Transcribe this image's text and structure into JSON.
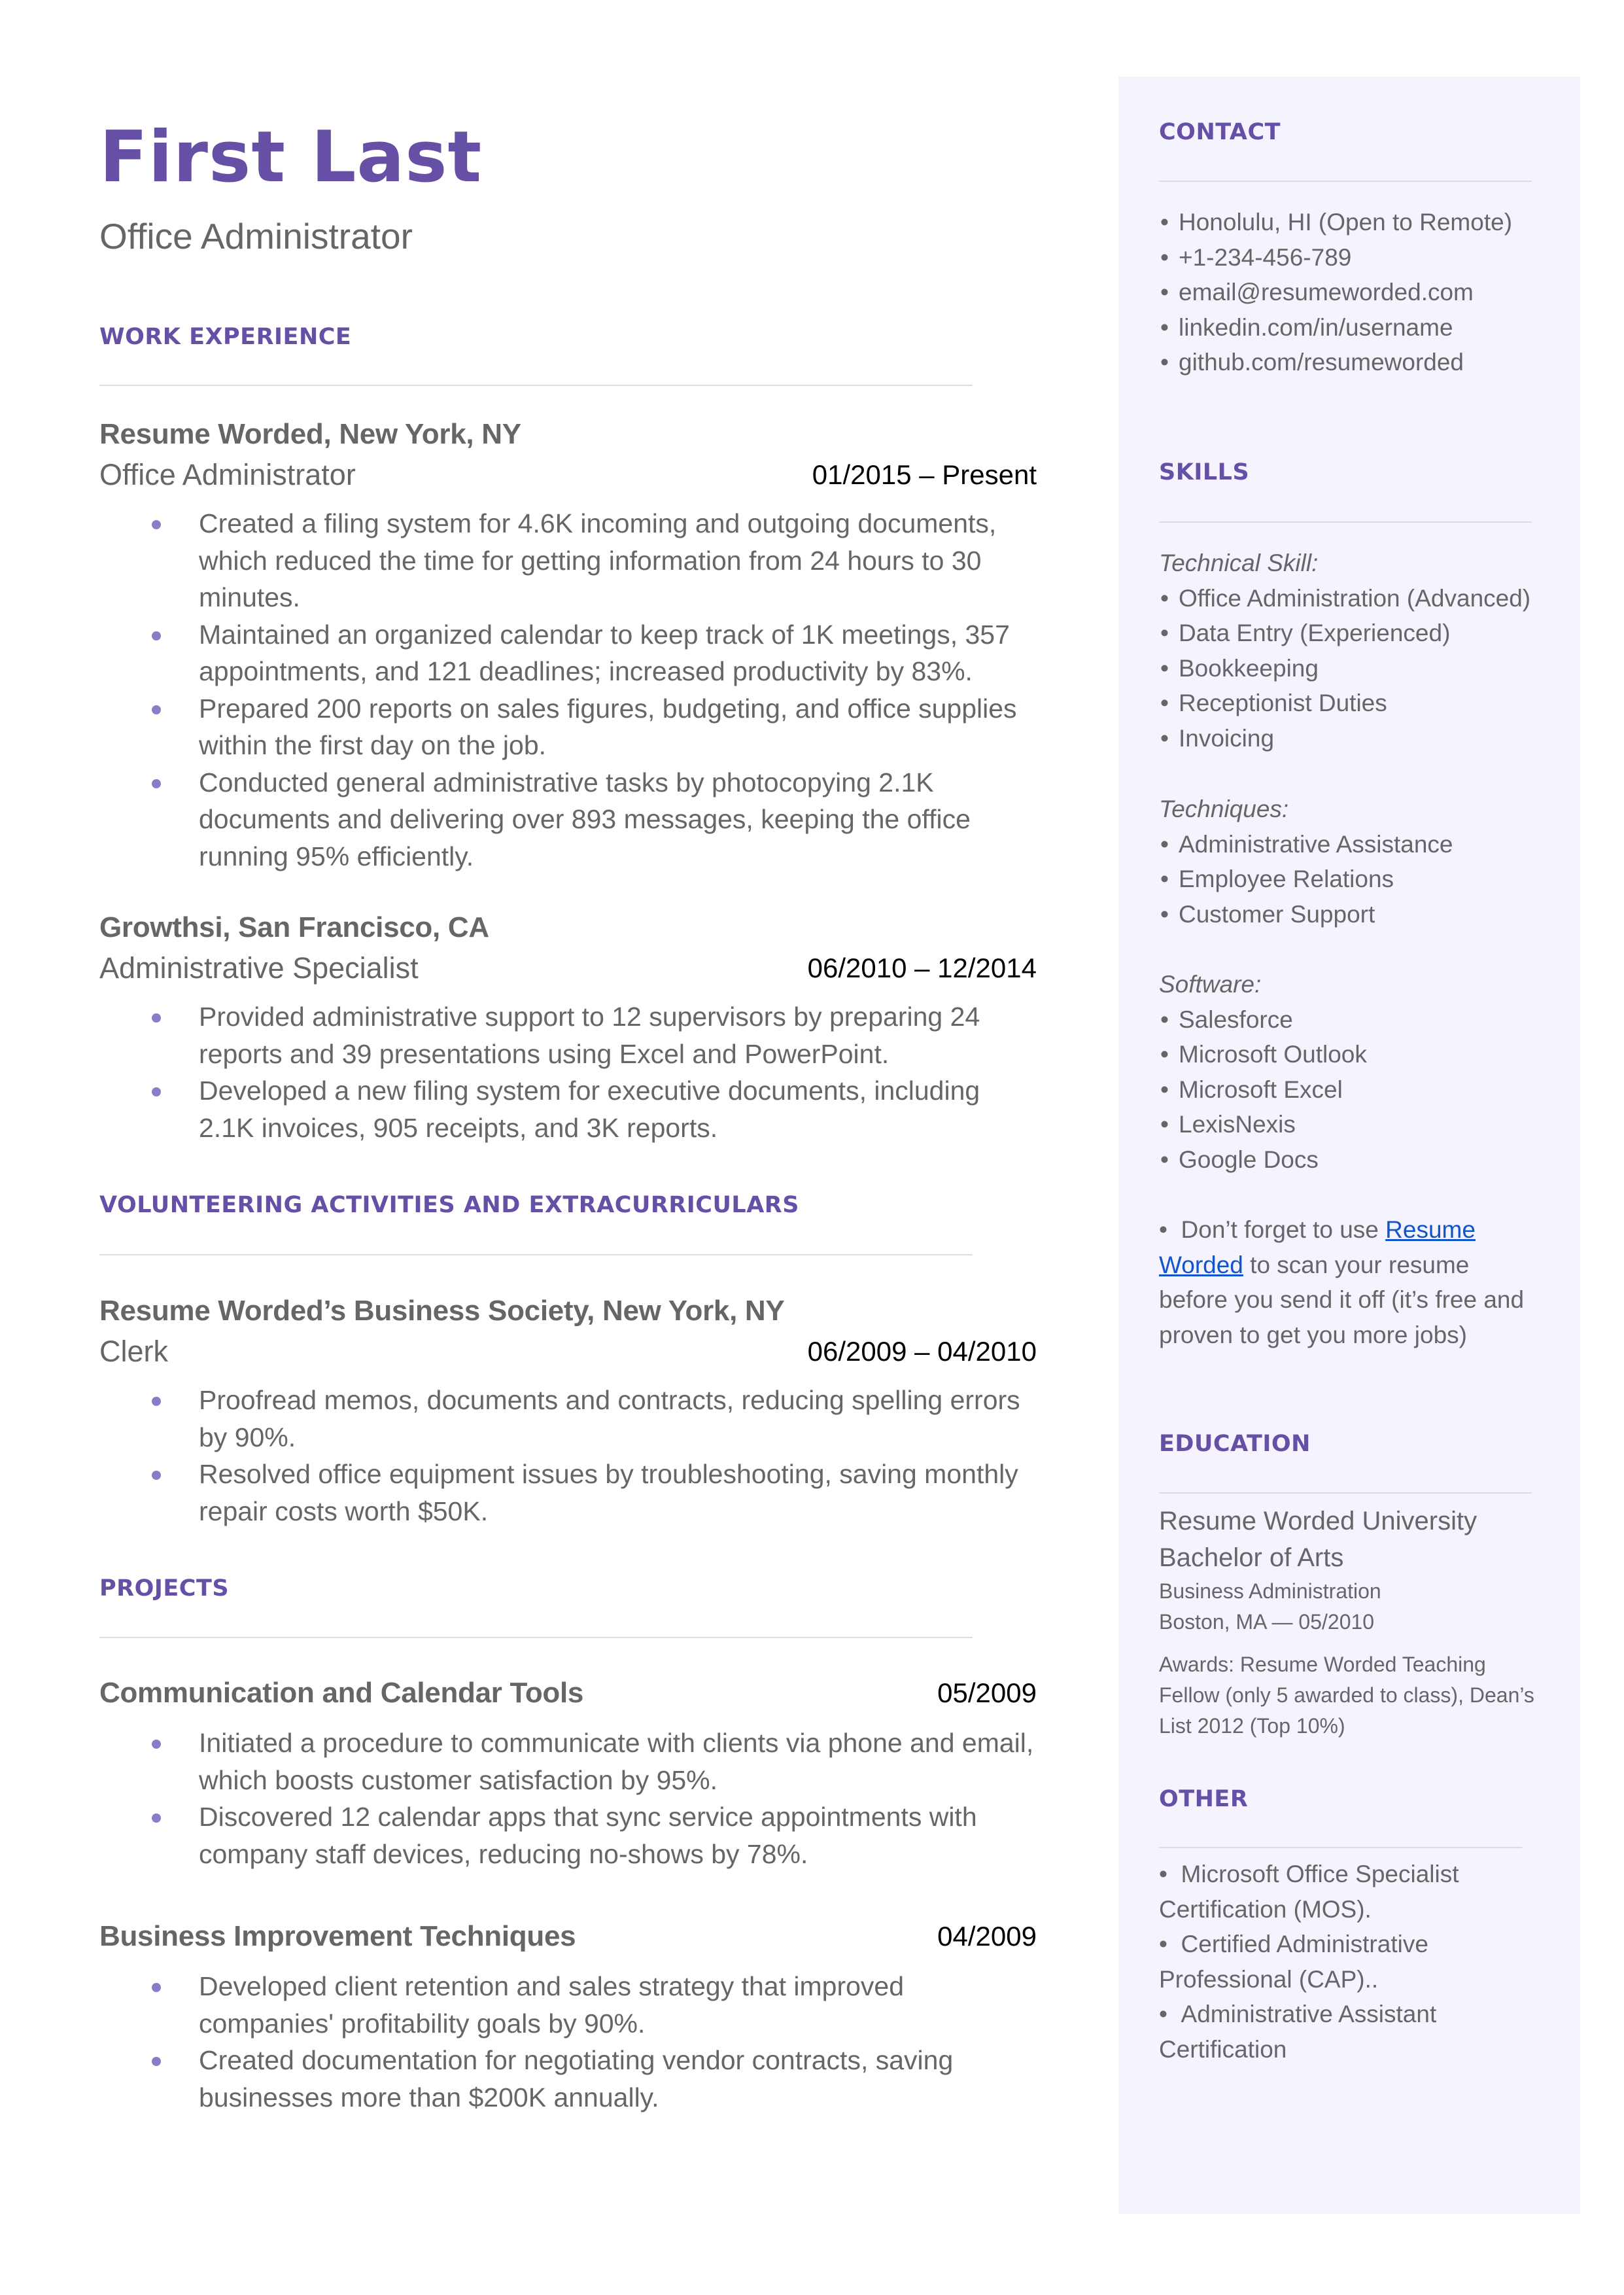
{
  "header": {
    "name": "First Last",
    "headline": "Office Administrator"
  },
  "colors": {
    "accent": "#6650a6",
    "bullet": "#8b7cc8",
    "sidebar_bg": "#f5f3fe",
    "link": "#1155cc",
    "text": "#666666"
  },
  "work_experience": {
    "title": "WORK EXPERIENCE",
    "jobs": [
      {
        "org": "Resume Worded, New York, NY",
        "role": "Office Administrator",
        "dates": "01/2015 – Present",
        "bullets": [
          "Created a filing system for 4.6K incoming and outgoing documents, which reduced the time for getting information from 24 hours to 30 minutes.",
          "Maintained an organized calendar to keep track of 1K meetings, 357 appointments, and 121 deadlines;  increased productivity by 83%.",
          "Prepared 200 reports on sales figures, budgeting, and office supplies within the first day on the job.",
          "Conducted general administrative tasks by photocopying 2.1K documents and delivering over 893 messages, keeping the office running 95% efficiently."
        ]
      },
      {
        "org": "Growthsi, San Francisco, CA",
        "role": "Administrative Specialist",
        "dates": "06/2010 – 12/2014",
        "bullets": [
          "Provided administrative support to 12 supervisors by preparing 24 reports and 39 presentations using Excel and PowerPoint.",
          "Developed a new filing system for executive documents, including 2.1K invoices, 905 receipts, and 3K reports."
        ]
      }
    ]
  },
  "volunteering": {
    "title": "VOLUNTEERING ACTIVITIES AND EXTRACURRICULARS",
    "entries": [
      {
        "org": "Resume Worded’s Business Society, New York, NY",
        "role": "Clerk",
        "dates": "06/2009 – 04/2010",
        "bullets": [
          "Proofread memos, documents and contracts, reducing spelling errors by 90%.",
          "Resolved office equipment issues by troubleshooting, saving monthly repair costs worth $50K."
        ]
      }
    ]
  },
  "projects": {
    "title": "PROJECTS",
    "entries": [
      {
        "name": "Communication and Calendar Tools",
        "date": "05/2009",
        "bullets": [
          "Initiated a procedure to communicate with clients via phone and email, which boosts customer satisfaction by 95%.",
          "Discovered 12 calendar apps that sync service appointments with company staff devices, reducing no-shows by 78%."
        ]
      },
      {
        "name": "Business Improvement Techniques",
        "date": "04/2009",
        "bullets": [
          "Developed client retention and sales strategy that improved companies' profitability goals by 90%.",
          "Created documentation for negotiating vendor contracts, saving businesses more than $200K annually."
        ]
      }
    ]
  },
  "sidebar": {
    "bullet_glyph": "•",
    "contact": {
      "title": "CONTACT",
      "items": [
        "Honolulu, HI (Open to Remote)",
        "+1-234-456-789",
        "email@resumeworded.com",
        "linkedin.com/in/username",
        "github.com/resumeworded"
      ]
    },
    "skills": {
      "title": "SKILLS",
      "groups": [
        {
          "label": "Technical Skill:",
          "items": [
            "Office Administration (Advanced)",
            "Data Entry (Experienced)",
            "Bookkeeping",
            "Receptionist Duties",
            "Invoicing"
          ]
        },
        {
          "label": "Techniques:",
          "items": [
            "Administrative Assistance",
            "Employee Relations",
            "Customer Support"
          ]
        },
        {
          "label": "Software:",
          "items": [
            "Salesforce",
            "Microsoft Outlook",
            "Microsoft Excel",
            "LexisNexis",
            "Google Docs"
          ]
        }
      ],
      "tip": {
        "prefix": "Don’t forget to use ",
        "link_text": "Resume Worded",
        "suffix": " to scan your resume before you send it off (it’s free and proven to get you more jobs)"
      }
    },
    "education": {
      "title": "EDUCATION",
      "school": "Resume Worded University",
      "degree": "Bachelor of Arts",
      "field": "Business Administration",
      "location_date": "Boston, MA — 05/2010",
      "awards": "Awards: Resume Worded Teaching Fellow (only 5 awarded to class), Dean’s List 2012 (Top 10%)"
    },
    "other": {
      "title": "OTHER",
      "items": [
        "Microsoft Office Specialist Certification (MOS).",
        "Certified Administrative Professional (CAP)..",
        "Administrative Assistant Certification"
      ]
    }
  }
}
